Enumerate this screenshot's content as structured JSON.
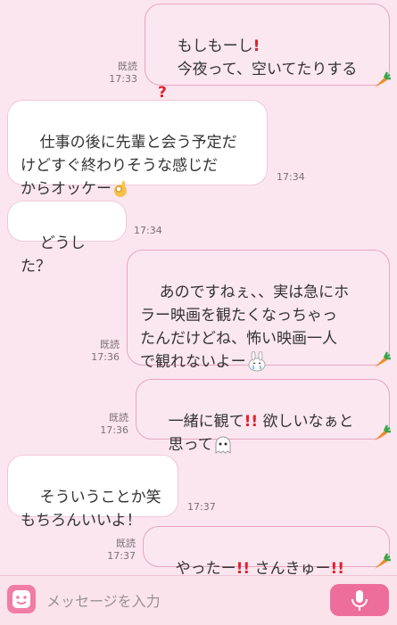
{
  "messages": [
    {
      "dir": "out",
      "line1": "もしもーし",
      "line2": "今夜って、空いてたりする",
      "read": "既読",
      "time": "17:33"
    },
    {
      "dir": "in",
      "text": "仕事の後に先輩と会う予定だ\nけどすぐ終わりそうな感じだ\nからオッケー",
      "time": "17:34"
    },
    {
      "dir": "in",
      "text": "どうした？",
      "time": "17:34"
    },
    {
      "dir": "out",
      "text": "あのですねぇ、、実は急にホ\nラー映画を観たくなっちゃっ\nたんだけどね、怖い映画一人\nで観れないよー",
      "read": "既読",
      "time": "17:36"
    },
    {
      "dir": "out",
      "line1a": "一緒に観て",
      "line1b": "欲しいなぁと",
      "line2": "思って",
      "read": "既読",
      "time": "17:36"
    },
    {
      "dir": "in",
      "text": "そういうことか笑\nもちろんいいよ！",
      "time": "17:37"
    },
    {
      "dir": "out",
      "parta": "やったー",
      "partb": "さんきゅー",
      "read": "既読",
      "time": "17:37"
    }
  ],
  "input": {
    "placeholder": "メッセージを入力"
  },
  "icons": {
    "stamp": "sticker-icon",
    "mic": "microphone-icon",
    "carrot": "carrot-icon",
    "ok": "ok-hand-emoji",
    "bunny": "crying-bunny-emoji",
    "ghost": "ghost-emoji"
  },
  "colors": {
    "background": "#fbe6ef",
    "accent": "#ee6e9b",
    "bang": "#e0202e"
  }
}
